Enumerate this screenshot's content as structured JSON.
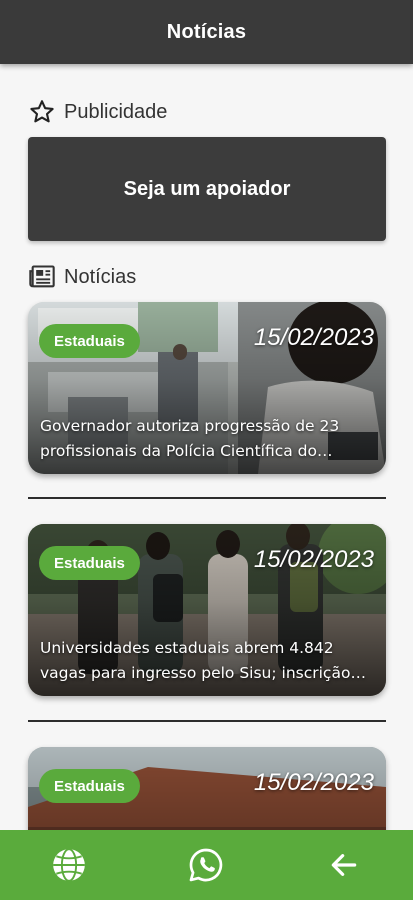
{
  "appbar": {
    "title": "Notícias"
  },
  "sections": {
    "ads_title": "Publicidade",
    "news_title": "Notícias"
  },
  "ad": {
    "label": "Seja um apoiador"
  },
  "news": [
    {
      "category": "Estaduais",
      "date": "15/02/2023",
      "title": "Governador autoriza progressão de 23 profissionais da Polícia Científica do Paraná"
    },
    {
      "category": "Estaduais",
      "date": "15/02/2023",
      "title": "Universidades estaduais abrem 4.842 vagas para ingresso pelo Sisu; inscrição abre nesta quarta-feira"
    },
    {
      "category": "Estaduais",
      "date": "15/02/2023",
      "title": ""
    }
  ],
  "bottom_nav": {
    "items": [
      {
        "icon": "globe-icon"
      },
      {
        "icon": "whatsapp-icon"
      },
      {
        "icon": "arrow-left-icon"
      }
    ]
  },
  "colors": {
    "appbar": "#3a3a3a",
    "accent": "#5aab3c",
    "ad_background": "#3c3c3c"
  }
}
